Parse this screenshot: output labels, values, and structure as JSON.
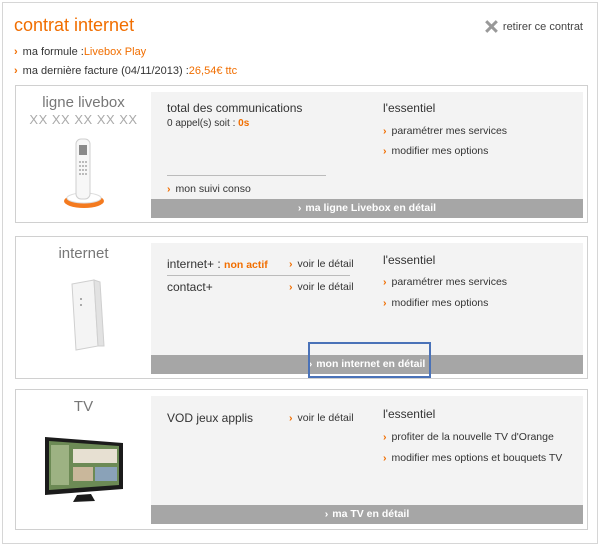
{
  "header": {
    "title": "contrat internet",
    "remove_label": "retirer ce contrat",
    "formula_label": "ma formule :",
    "formula_value": "Livebox Play",
    "invoice_label": "ma dernière facture (04/11/2013) :",
    "invoice_value": "26,54€ ttc"
  },
  "livebox": {
    "name": "ligne livebox",
    "number": "XX XX XX XX XX",
    "comm_title": "total des communications",
    "comm_text": "0 appel(s) soit :",
    "comm_value": "0s",
    "suivi_link": "mon suivi conso",
    "essentiel": "l'essentiel",
    "link1": "paramétrer mes services",
    "link2": "modifier mes options",
    "detail_bar": "ma ligne Livebox en détail"
  },
  "internet": {
    "name": "internet",
    "row1_label": "internet+ :",
    "row1_status": "non actif",
    "row1_link": "voir le détail",
    "row2_label": "contact+",
    "row2_link": "voir le détail",
    "essentiel": "l'essentiel",
    "link1": "paramétrer mes services",
    "link2": "modifier mes options",
    "detail_bar": "mon internet en détail"
  },
  "tv": {
    "name": "TV",
    "row1_label": "VOD jeux applis",
    "row1_link": "voir le détail",
    "essentiel": "l'essentiel",
    "link1": "profiter de la nouvelle TV d'Orange",
    "link2": "modifier mes options et bouquets TV",
    "detail_bar": "ma TV en détail"
  },
  "icons": {
    "chevron": "›",
    "close": "close-icon"
  },
  "colors": {
    "accent": "#f16e00",
    "bar": "#a6a6a6",
    "highlight": "#4a72b8"
  }
}
